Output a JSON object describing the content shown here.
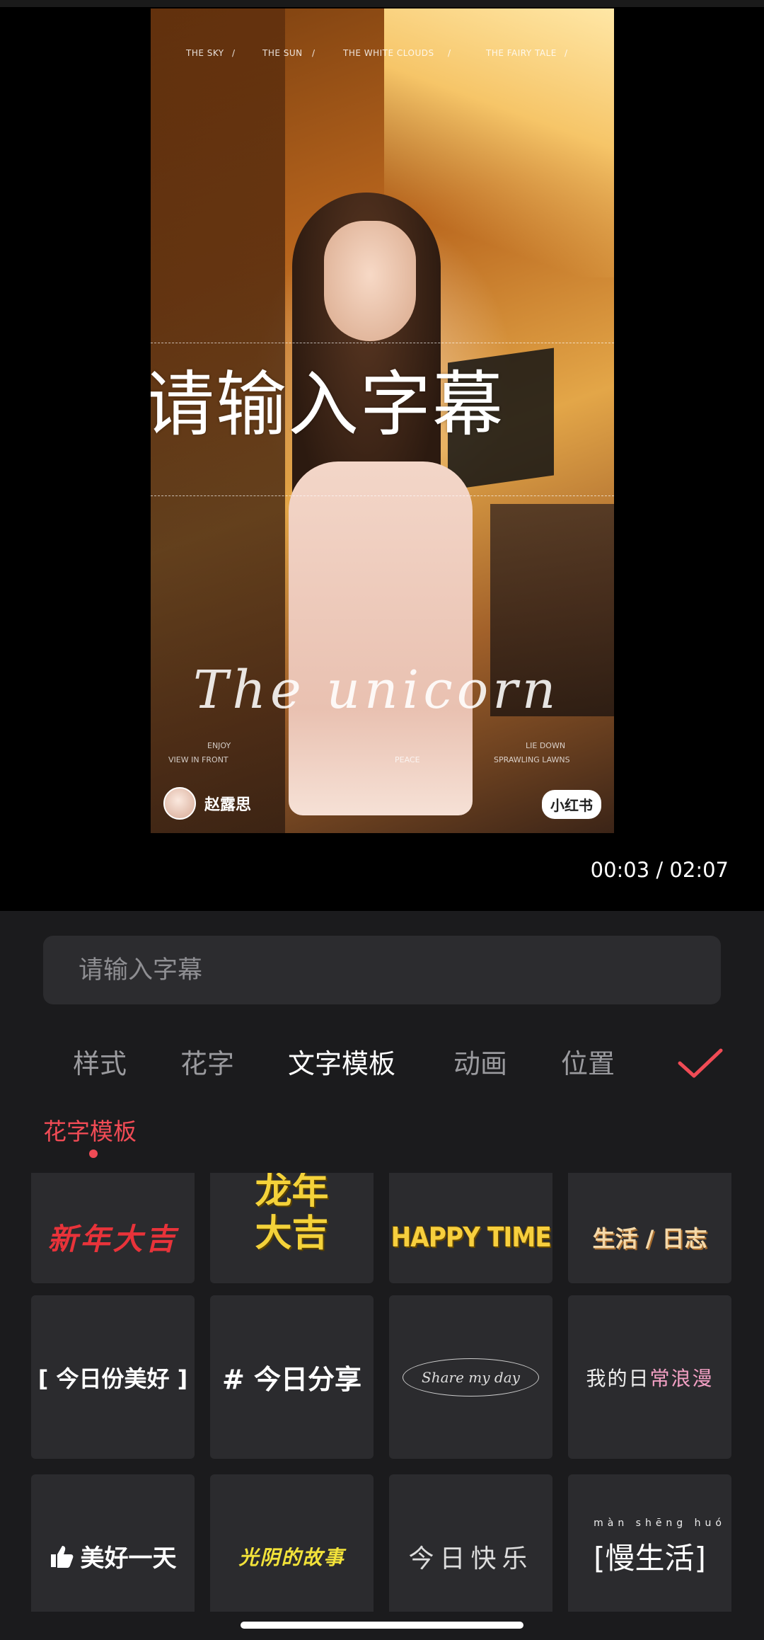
{
  "video": {
    "overlay_captions": [
      "THE SKY",
      "/",
      "THE SUN",
      "/",
      "THE WHITE CLOUDS",
      "/",
      "THE FAIRY TALE",
      "/"
    ],
    "subtitle_preview": "请输入字幕",
    "script_text": "The unicorn",
    "small_captions": [
      "ENJOY",
      "VIEW IN FRONT",
      "PEACE",
      "LIE DOWN",
      "SPRAWLING LAWNS"
    ],
    "watermark_user": "赵露思",
    "watermark_brand": "小红书"
  },
  "player": {
    "current_time": "00:03",
    "separator": "/",
    "total_time": "02:07"
  },
  "editor": {
    "subtitle_placeholder": "请输入字幕",
    "tabs": [
      {
        "label": "样式",
        "active": false
      },
      {
        "label": "花字",
        "active": false
      },
      {
        "label": "文字模板",
        "active": true
      },
      {
        "label": "动画",
        "active": false
      },
      {
        "label": "位置",
        "active": false
      }
    ],
    "confirm_icon": "checkmark-icon",
    "section_label": "花字模板",
    "accent_color": "#f04b55",
    "templates": [
      {
        "text": "新年大吉"
      },
      {
        "text": "龙年大吉"
      },
      {
        "text": "HAPPY TIME"
      },
      {
        "text": "生活 / 日志"
      },
      {
        "text": "[ 今日份美好 ]"
      },
      {
        "text": "# 今日分享"
      },
      {
        "text": "Share my day"
      },
      {
        "text_part1": "我的日",
        "text_part2": "常浪漫"
      },
      {
        "text": "美好一天",
        "icon": "thumbs-up-icon"
      },
      {
        "text": "光阴的故事"
      },
      {
        "text": "今日快乐"
      },
      {
        "text": "[慢生活]",
        "pinyin": "màn shēng huó"
      }
    ]
  }
}
